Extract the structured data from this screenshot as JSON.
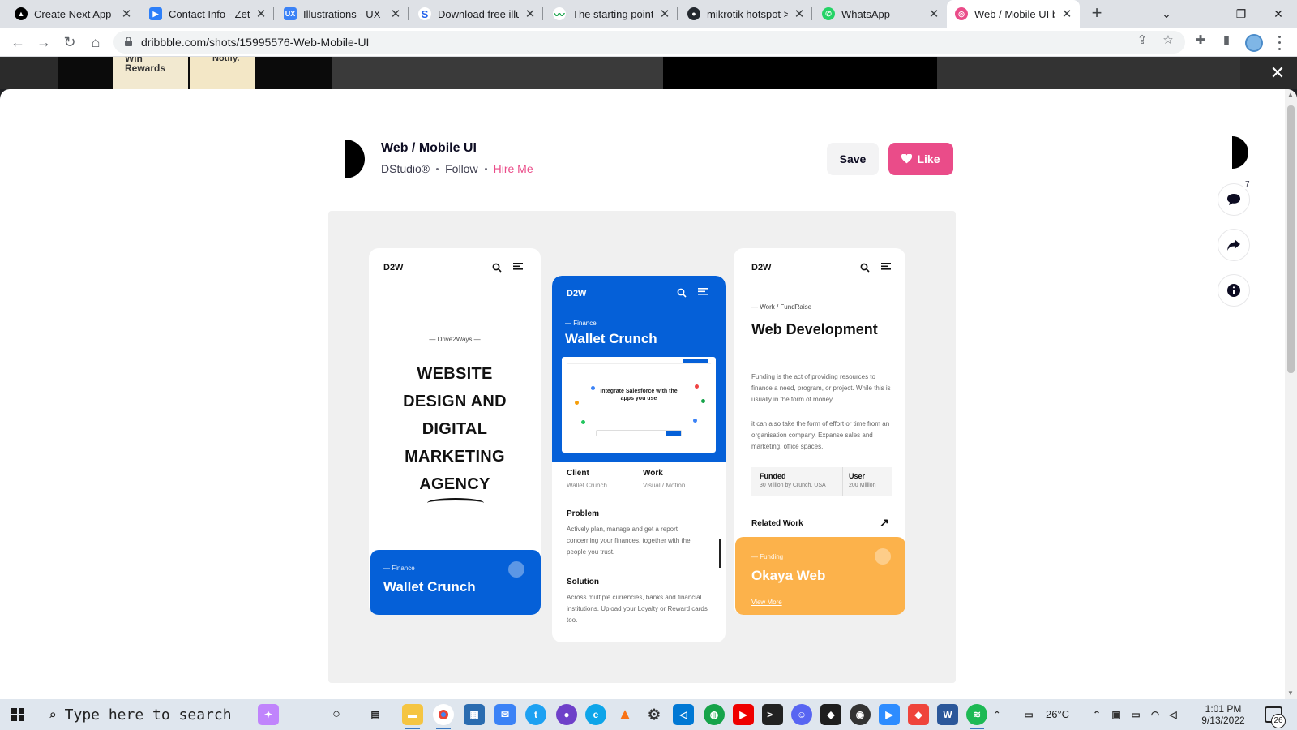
{
  "browser": {
    "tabs": [
      {
        "title": "Create Next App",
        "icon": "nextjs-icon",
        "color": "#000000",
        "active": false
      },
      {
        "title": "Contact Info - Zety",
        "icon": "zety-icon",
        "color": "#2d7ff9",
        "active": false
      },
      {
        "title": "Illustrations - UX L",
        "icon": "ux-icon",
        "color": "#3b82f6",
        "active": false
      },
      {
        "title": "Download free illus",
        "icon": "s-icon",
        "color": "#2563eb",
        "active": false
      },
      {
        "title": "The starting point f",
        "icon": "green-icon",
        "color": "#16a34a",
        "active": false
      },
      {
        "title": "mikrotik hotspot >",
        "icon": "github-icon",
        "color": "#24292f",
        "active": false
      },
      {
        "title": "WhatsApp",
        "icon": "whatsapp-icon",
        "color": "#25d366",
        "active": false
      },
      {
        "title": "Web / Mobile UI b",
        "icon": "dribbble-icon",
        "color": "#ea4c89",
        "active": true
      }
    ],
    "new_tab_label": "+",
    "url": "dribbble.com/shots/15995576-Web-Mobile-UI"
  },
  "backdrop": {
    "text": "Win Rewards",
    "text2": "Notify."
  },
  "shot": {
    "title": "Web / Mobile UI",
    "author": "DStudio®",
    "follow_label": "Follow",
    "hire_label": "Hire Me",
    "save_label": "Save",
    "like_label": "Like",
    "comment_count": "7"
  },
  "artwork": {
    "screen1": {
      "brand": "D2W",
      "eyebrow": "— Drive2Ways —",
      "headline": [
        "WEBSITE",
        "DESIGN AND",
        "DIGITAL",
        "MARKETING",
        "AGENCY"
      ],
      "card_eyebrow": "— Finance",
      "card_title": "Wallet Crunch"
    },
    "screen2": {
      "brand": "D2W",
      "eyebrow": "— Finance",
      "title": "Wallet Crunch",
      "preview_text": "Integrate Salesforce with the apps you use",
      "client_label": "Client",
      "client_value": "Wallet Crunch",
      "work_label": "Work",
      "work_value": "Visual / Motion",
      "problem_label": "Problem",
      "problem_text": "Actively plan, manage and get a report concerning your finances, together with the people you trust.",
      "solution_label": "Solution",
      "solution_text": "Across multiple currencies, banks and financial institutions. Upload your Loyalty or Reward cards too."
    },
    "screen3": {
      "brand": "D2W",
      "eyebrow": "— Work / FundRaise",
      "title": "Web Development",
      "desc1": "Funding is the act of providing resources to finance a need, program, or project. While this is usually in the form of money,",
      "desc2": "it can also take the form of effort or time from an organisation company. Expanse sales and marketing, office spaces.",
      "funded_label": "Funded",
      "funded_value": "30 Million by Crunch, USA",
      "user_label": "User",
      "user_value": "200 Million",
      "related_label": "Related Work",
      "card_eyebrow": "— Funding",
      "card_title": "Okaya Web",
      "card_link": "View More"
    }
  },
  "taskbar": {
    "search_placeholder": "Type here to search",
    "weather": "26°C",
    "time": "1:01 PM",
    "date": "9/13/2022",
    "notification_count": "26",
    "apps": [
      "widgets",
      "cortana",
      "task-view",
      "file-explorer",
      "chrome",
      "store",
      "mail",
      "twitter",
      "github-desktop",
      "edge",
      "vlc",
      "settings",
      "vscode",
      "earth",
      "youtube",
      "terminal",
      "discord",
      "figma",
      "media-player",
      "zoom",
      "anydesk",
      "word",
      "spotify"
    ]
  },
  "colors": {
    "dribbble_pink": "#ea4c89",
    "finance_blue": "#0560d8",
    "funding_orange": "#fcb24b"
  }
}
